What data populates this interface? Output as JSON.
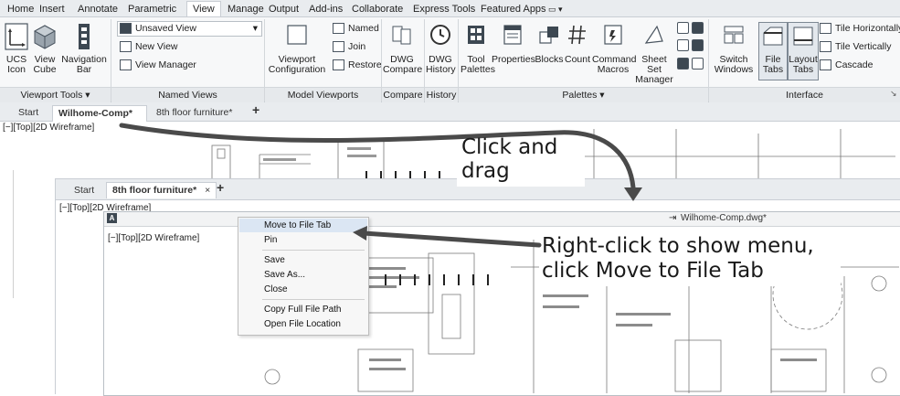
{
  "ribbon": {
    "tabs": [
      "Home",
      "Insert",
      "Annotate",
      "Parametric",
      "View",
      "Manage",
      "Output",
      "Add-ins",
      "Collaborate",
      "Express Tools",
      "Featured Apps"
    ],
    "active_tab": "View",
    "viewport_tools": {
      "title": "Viewport Tools ▾",
      "ucs_icon": "UCS Icon",
      "view_cube": "View Cube",
      "navigation_bar": "Navigation Bar"
    },
    "named_views": {
      "title": "Named Views",
      "dropdown_value": "Unsaved View",
      "new_view": "New View",
      "view_manager": "View Manager"
    },
    "model_viewports": {
      "title": "Model Viewports",
      "viewport_configuration": "Viewport Configuration",
      "named": "Named",
      "join": "Join",
      "restore": "Restore"
    },
    "compare": {
      "title": "Compare",
      "dwg_compare": "DWG Compare"
    },
    "history": {
      "title": "History",
      "dwg_history": "DWG History"
    },
    "palettes": {
      "title": "Palettes ▾",
      "tool_palettes": "Tool Palettes",
      "properties": "Properties",
      "blocks": "Blocks",
      "count": "Count",
      "command_macros": "Command Macros",
      "sheet_set_manager": "Sheet Set Manager"
    },
    "interface": {
      "title": "Interface",
      "switch_windows": "Switch Windows",
      "file_tabs": "File Tabs",
      "layout_tabs": "Layout Tabs",
      "tile_horizontally": "Tile Horizontally",
      "tile_vertically": "Tile Vertically",
      "cascade": "Cascade"
    }
  },
  "file_tabs_top": {
    "start": "Start",
    "tab1": "Wilhome-Comp*",
    "tab1_close": "×",
    "tab2": "8th floor furniture*",
    "add": "+"
  },
  "view_label_top": "[−][Top][2D Wireframe]",
  "second_window": {
    "tabs": {
      "start": "Start",
      "tab1": "8th floor furniture*",
      "tab1_close": "×",
      "add": "+"
    },
    "view_label": "[−][Top][2D Wireframe]",
    "floating_title": "Wilhome-Comp.dwg*",
    "floating_view_label": "[−][Top][2D Wireframe]"
  },
  "context_menu": {
    "items": [
      "Move to File Tab",
      "Pin",
      "Save",
      "Save As...",
      "Close",
      "Copy Full File Path",
      "Open File Location"
    ]
  },
  "annotations": {
    "drag_line1": "Click and",
    "drag_line2": "drag",
    "menu_line1": "Right-click to show menu,",
    "menu_line2": "click Move to File Tab"
  },
  "colors": {
    "arrow": "#4a4a4a",
    "menu_highlight": "#dbe6f3",
    "ribbon_bg": "#f7f8f9"
  }
}
